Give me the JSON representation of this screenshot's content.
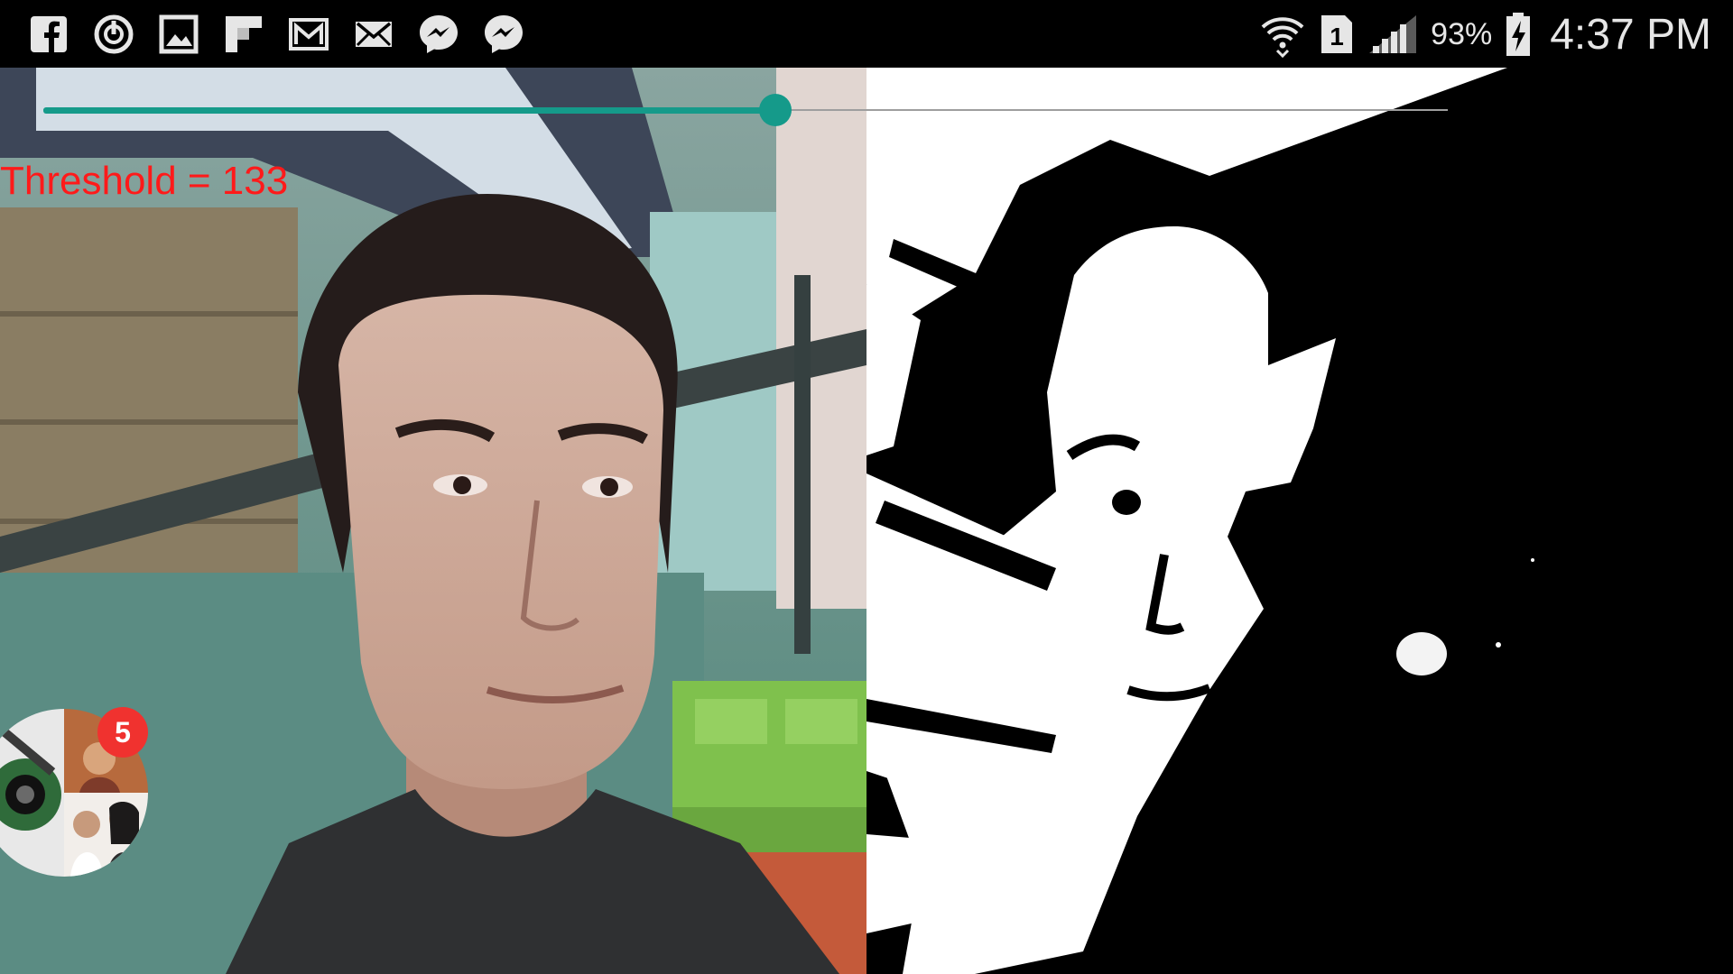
{
  "status_bar": {
    "notification_icons": [
      "facebook-icon",
      "power-icon",
      "gallery-icon",
      "flipboard-icon",
      "gmail-icon",
      "email-icon",
      "messenger-icon",
      "messenger-icon"
    ],
    "sim_slot": "1",
    "battery_percent": "93%",
    "time": "4:37 PM"
  },
  "controls": {
    "threshold_label": "Threshold = 133",
    "seekbar_fraction": 0.521,
    "accent_color": "#159a8a",
    "label_color": "#ff1a1a"
  },
  "chat_head": {
    "badge_count": "5",
    "badge_color": "#f0322f"
  }
}
